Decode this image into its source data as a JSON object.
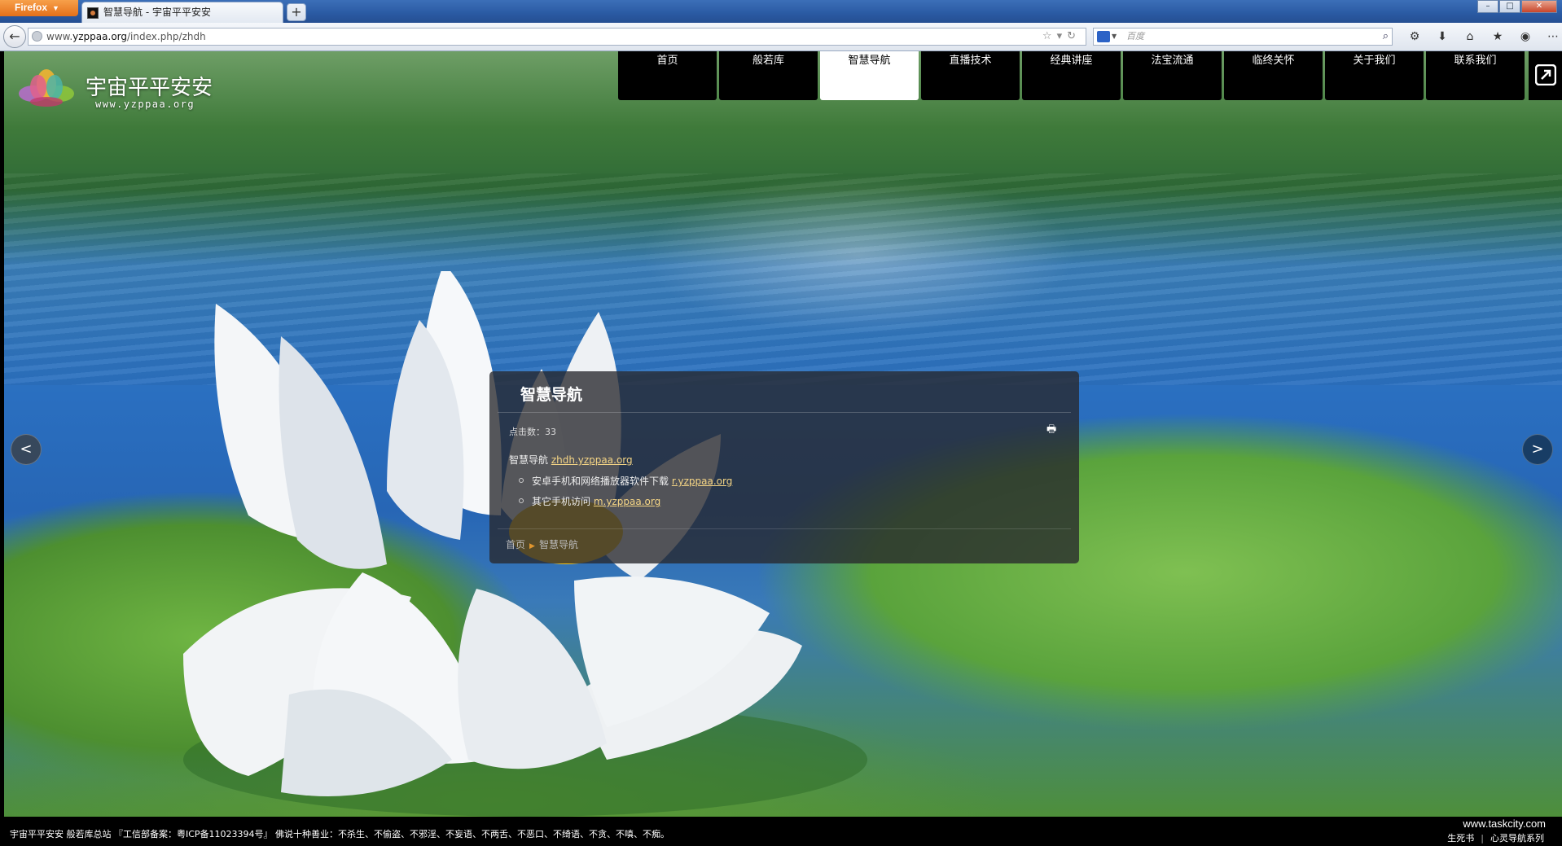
{
  "browser": {
    "app_button": "Firefox",
    "tab_title": "智慧导航 - 宇宙平平安安",
    "new_tab": "+",
    "url_prefix": "www.",
    "url_domain": "yzppaa.org",
    "url_path": "/index.php/zhdh",
    "search_placeholder": "百度"
  },
  "site": {
    "logo_title": "宇宙平平安安",
    "logo_subtitle": "www.yzppaa.org",
    "menu": [
      {
        "label": "首页"
      },
      {
        "label": "般若库"
      },
      {
        "label": "智慧导航",
        "active": true
      },
      {
        "label": "直播技术"
      },
      {
        "label": "经典讲座"
      },
      {
        "label": "法宝流通"
      },
      {
        "label": "临终关怀"
      },
      {
        "label": "关于我们"
      },
      {
        "label": "联系我们"
      }
    ]
  },
  "article": {
    "title": "智慧导航",
    "hits": "点击数：33",
    "intro_text": "智慧导航",
    "intro_link": "zhdh.yzppaa.org",
    "items": [
      {
        "text": "安卓手机和网络播放器软件下载",
        "link": "r.yzppaa.org"
      },
      {
        "text": "其它手机访问",
        "link": "m.yzppaa.org"
      }
    ],
    "breadcrumb": [
      "首页",
      "智慧导航"
    ]
  },
  "footer": {
    "notice": "宇宙平平安安 般若库总站 『工信部备案：粤ICP备11023394号』 佛说十种善业：不杀生、不偷盗、不邪淫、不妄语、不两舌、不恶口、不绮语、不贪、不嗔、不痴。",
    "brand": "www.taskcity.com",
    "link1": "生死书",
    "separator": "|",
    "link2": "心灵导航系列"
  },
  "icons": {
    "back": "arrow-left-icon",
    "prev": "chevron-left-icon",
    "next": "chevron-right-icon",
    "print": "printer-icon",
    "fullscreen": "expand-icon"
  }
}
